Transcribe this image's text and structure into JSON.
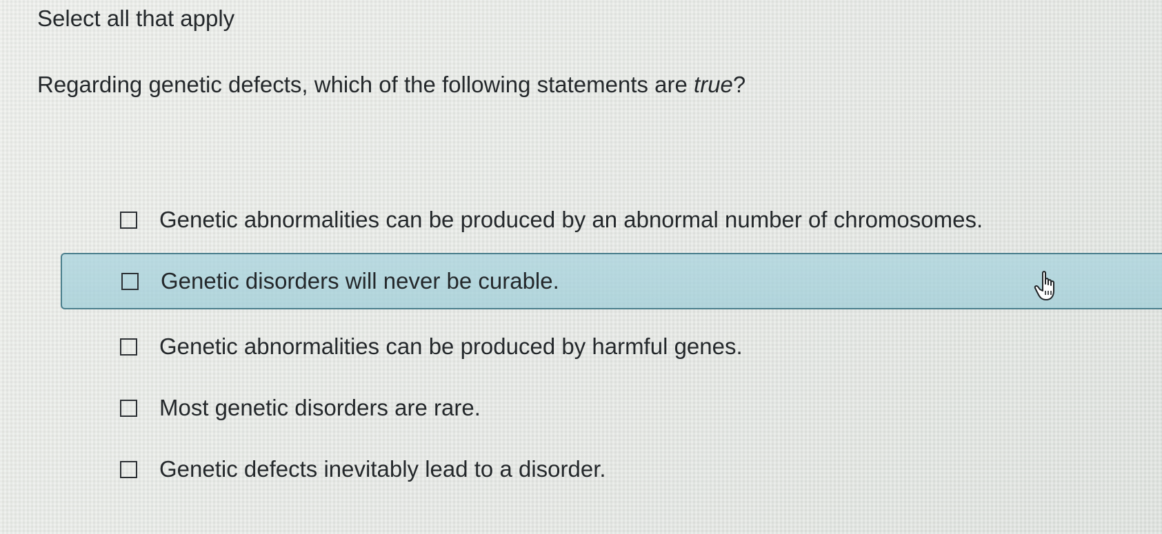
{
  "instruction": "Select all that apply",
  "question": {
    "text_before": "Regarding genetic defects, which of the following statements are ",
    "text_emphasis": "true",
    "text_after": "?"
  },
  "options": [
    {
      "label": "Genetic abnormalities can be produced by an abnormal number of chromosomes.",
      "checked": false,
      "highlighted": false
    },
    {
      "label": "Genetic disorders will never be curable.",
      "checked": false,
      "highlighted": true
    },
    {
      "label": "Genetic abnormalities can be produced by harmful genes.",
      "checked": false,
      "highlighted": false
    },
    {
      "label": "Most genetic disorders are rare.",
      "checked": false,
      "highlighted": false
    },
    {
      "label": "Genetic defects inevitably lead to a disorder.",
      "checked": false,
      "highlighted": false
    }
  ],
  "highlight_color": "#a8d3dc",
  "cursor": "hand-pointer-icon"
}
